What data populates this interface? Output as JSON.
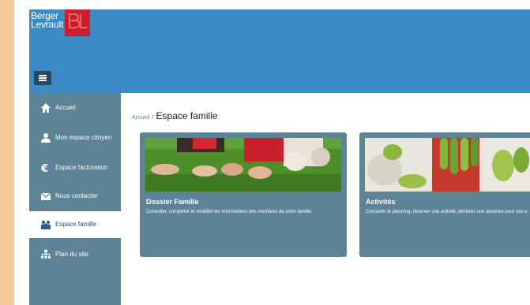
{
  "brand": {
    "logo_line1": "Berger",
    "logo_line2": "Levrault",
    "logo_mark": "BL",
    "header_color": "#3b8ac4",
    "sidebar_color": "#5c8396"
  },
  "menu_toggle": {
    "icon": "hamburger-icon"
  },
  "sidebar": {
    "items": [
      {
        "label": "Accueil",
        "icon": "home-icon",
        "active": false
      },
      {
        "label": "Mon espace citoyen",
        "icon": "user-icon",
        "active": false
      },
      {
        "label": "Espace facturation",
        "icon": "euro-icon",
        "active": false
      },
      {
        "label": "Nous contacter",
        "icon": "envelope-icon",
        "active": false
      },
      {
        "label": "Espace famille",
        "icon": "family-icon",
        "active": true
      },
      {
        "label": "Plan du site",
        "icon": "sitemap-icon",
        "active": false
      }
    ]
  },
  "breadcrumb": {
    "home": "Accueil",
    "separator": "/",
    "current": "Espace famille"
  },
  "cards": [
    {
      "title": "Dossier Famille",
      "description": "Consulter, compléter et modifier les informations des membres de votre famille.",
      "image": "family-feet-on-grass"
    },
    {
      "title": "Activités",
      "description": "Consulter le planning, réserver une activité, déclarer une absence pour vos e",
      "image": "painted-hands"
    }
  ]
}
